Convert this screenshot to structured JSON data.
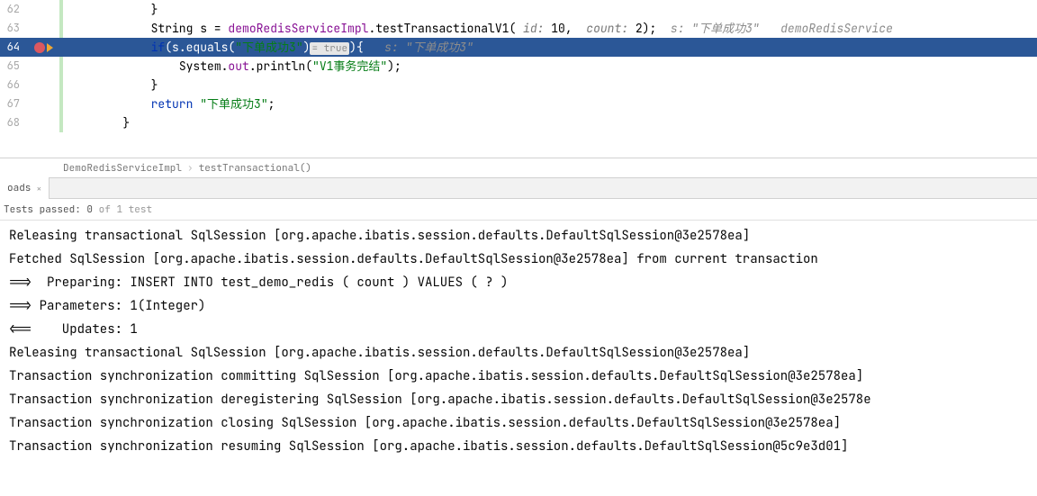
{
  "editor": {
    "lines": [
      {
        "num": "62",
        "indent": "            ",
        "parts": [
          {
            "t": "plain",
            "v": "}"
          }
        ]
      },
      {
        "num": "63",
        "indent": "            ",
        "parts": [
          {
            "t": "plain",
            "v": "String s = "
          },
          {
            "t": "field",
            "v": "demoRedisServiceImpl"
          },
          {
            "t": "plain",
            "v": ".testTransactionalV1( "
          },
          {
            "t": "hint",
            "v": "id: "
          },
          {
            "t": "plain",
            "v": "10,  "
          },
          {
            "t": "hint",
            "v": "count: "
          },
          {
            "t": "plain",
            "v": "2);  "
          },
          {
            "t": "comment",
            "v": "s: \"下单成功3\"   demoRedisService"
          }
        ]
      },
      {
        "num": "64",
        "indent": "            ",
        "highlighted": true,
        "breakpoint": true,
        "parts": [
          {
            "t": "kw",
            "v": "if"
          },
          {
            "t": "plain",
            "v": "(s.equals("
          },
          {
            "t": "str",
            "v": "\"下单成功3\""
          },
          {
            "t": "plain",
            "v": ")"
          },
          {
            "t": "inline-hint",
            "v": "= true"
          },
          {
            "t": "plain",
            "v": "){   "
          },
          {
            "t": "comment",
            "v": "s: \"下单成功3\""
          }
        ]
      },
      {
        "num": "65",
        "indent": "                ",
        "parts": [
          {
            "t": "plain",
            "v": "System."
          },
          {
            "t": "field",
            "v": "out"
          },
          {
            "t": "plain",
            "v": ".println("
          },
          {
            "t": "str",
            "v": "\"V1事务完结\""
          },
          {
            "t": "plain",
            "v": ");"
          }
        ]
      },
      {
        "num": "66",
        "indent": "            ",
        "parts": [
          {
            "t": "plain",
            "v": "}"
          }
        ]
      },
      {
        "num": "67",
        "indent": "            ",
        "parts": [
          {
            "t": "kw",
            "v": "return "
          },
          {
            "t": "str",
            "v": "\"下单成功3\""
          },
          {
            "t": "plain",
            "v": ";"
          }
        ]
      },
      {
        "num": "68",
        "indent": "        ",
        "parts": [
          {
            "t": "plain",
            "v": "}"
          }
        ]
      }
    ]
  },
  "breadcrumb": {
    "class": "DemoRedisServiceImpl",
    "method": "testTransactional()"
  },
  "tab": {
    "label": "oads",
    "close": "×"
  },
  "tests": {
    "label": "Tests passed:",
    "count": "0",
    "of": "of 1 test"
  },
  "console": {
    "lines": [
      "Releasing transactional SqlSession [org.apache.ibatis.session.defaults.DefaultSqlSession@3e2578ea]",
      "Fetched SqlSession [org.apache.ibatis.session.defaults.DefaultSqlSession@3e2578ea] from current transaction",
      "==>  Preparing: INSERT INTO test_demo_redis ( count ) VALUES ( ? )",
      "==> Parameters: 1(Integer)",
      "<==    Updates: 1",
      "Releasing transactional SqlSession [org.apache.ibatis.session.defaults.DefaultSqlSession@3e2578ea]",
      "Transaction synchronization committing SqlSession [org.apache.ibatis.session.defaults.DefaultSqlSession@3e2578ea]",
      "Transaction synchronization deregistering SqlSession [org.apache.ibatis.session.defaults.DefaultSqlSession@3e2578e",
      "Transaction synchronization closing SqlSession [org.apache.ibatis.session.defaults.DefaultSqlSession@3e2578ea]",
      "Transaction synchronization resuming SqlSession [org.apache.ibatis.session.defaults.DefaultSqlSession@5c9e3d01]"
    ]
  },
  "watermark": ""
}
